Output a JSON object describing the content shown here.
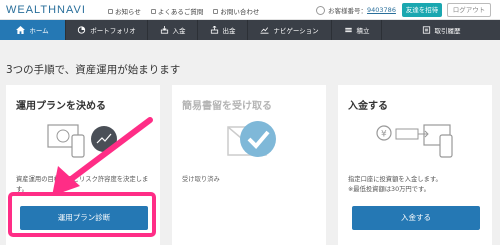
{
  "header": {
    "logo": "WEALTHNAVI",
    "links": [
      "お知らせ",
      "よくあるご質問",
      "お問い合わせ"
    ],
    "user_label": "お客様番号：",
    "user_number": "9403786",
    "invite_label": "友達を招待",
    "logout_label": "ログアウト"
  },
  "nav": {
    "items": [
      {
        "label": "ホーム",
        "icon": "home-icon"
      },
      {
        "label": "ポートフォリオ",
        "icon": "pie-chart-icon"
      },
      {
        "label": "入金",
        "icon": "deposit-icon"
      },
      {
        "label": "出金",
        "icon": "withdraw-icon"
      },
      {
        "label": "ナビゲーション",
        "icon": "chart-icon"
      },
      {
        "label": "積立",
        "icon": "stack-icon"
      },
      {
        "label": "取引履歴",
        "icon": "list-icon"
      }
    ]
  },
  "main": {
    "headline": "3つの手順で、資産運用が始まります",
    "cards": [
      {
        "title": "運用プランを決める",
        "desc": "資産運用の目標金額とリスク許容度を決定します。",
        "button": "運用プラン診断"
      },
      {
        "title": "簡易書留を受け取る",
        "desc": "受け取り済み"
      },
      {
        "title": "入金する",
        "desc": "指定口座に投資額を入金します。",
        "desc2": "※最低投資額は30万円です。",
        "button": "入金する"
      }
    ]
  },
  "colors": {
    "primary": "#2578b4",
    "nav_bg": "#3a3f47",
    "invite": "#1aa7b0",
    "highlight": "#ff2d86"
  }
}
